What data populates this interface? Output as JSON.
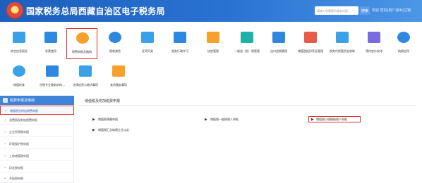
{
  "header": {
    "title": "国家税务总局西藏自治区电子税务局",
    "search_placeholder": "请输入您需要的服务内容",
    "search_button": "搜索",
    "user_info": "欢迎 您好|用户退出|注销"
  },
  "toolbar": {
    "row1": [
      {
        "label": "综合信息报告",
        "icon": "document-icon"
      },
      {
        "label": "发票使用",
        "icon": "invoice-icon"
      },
      {
        "label": "税费申报及缴纳",
        "icon": "tax-payment-icon"
      },
      {
        "label": "税收减免",
        "icon": "tax-relief-icon"
      },
      {
        "label": "证明开具",
        "icon": "certificate-folder-icon"
      },
      {
        "label": "税务行政许可",
        "icon": "license-icon"
      },
      {
        "label": "核定管理",
        "icon": "approval-icon"
      },
      {
        "label": "一般退（抵）税管理",
        "icon": "refund-icon"
      },
      {
        "label": "出口退税管理",
        "icon": "export-refund-icon"
      },
      {
        "label": "增值税抵扣凭证管理",
        "icon": "deduction-voucher-icon"
      },
      {
        "label": "税务代保管资金收取",
        "icon": "custody-fund-icon"
      },
      {
        "label": "预约定价安排",
        "icon": "pricing-arrangement-icon"
      },
      {
        "label": "纳税信用",
        "icon": "credit-icon"
      }
    ],
    "row2": [
      {
        "label": "增值检查",
        "icon": "shield-check-icon"
      },
      {
        "label": "涉税专业服务机构…",
        "icon": "service-agency-icon"
      },
      {
        "label": "法律追责与救济事项",
        "icon": "legal-book-icon"
      },
      {
        "label": "其他服务事项",
        "icon": "handshake-icon"
      }
    ]
  },
  "sidebar": {
    "header": "税费申报及缴纳",
    "items": [
      "增值税及附加税费申报",
      "消费税及附加税费申报",
      "企业所得税申报",
      "环境保护税申报",
      "土地增值税申报",
      "印花税申报",
      "车船税申报"
    ]
  },
  "main": {
    "title": "增值税及附加税费申报",
    "options": [
      "增值税预缴申报",
      "增值税一般纳税人申报",
      "增值税小规模纳税人申报",
      "增值税汇总纳税企业认定"
    ]
  },
  "colors": {
    "header_blue": "#2a73d3",
    "highlight_red": "#e03030",
    "sidebar_header": "#3e84d8"
  }
}
